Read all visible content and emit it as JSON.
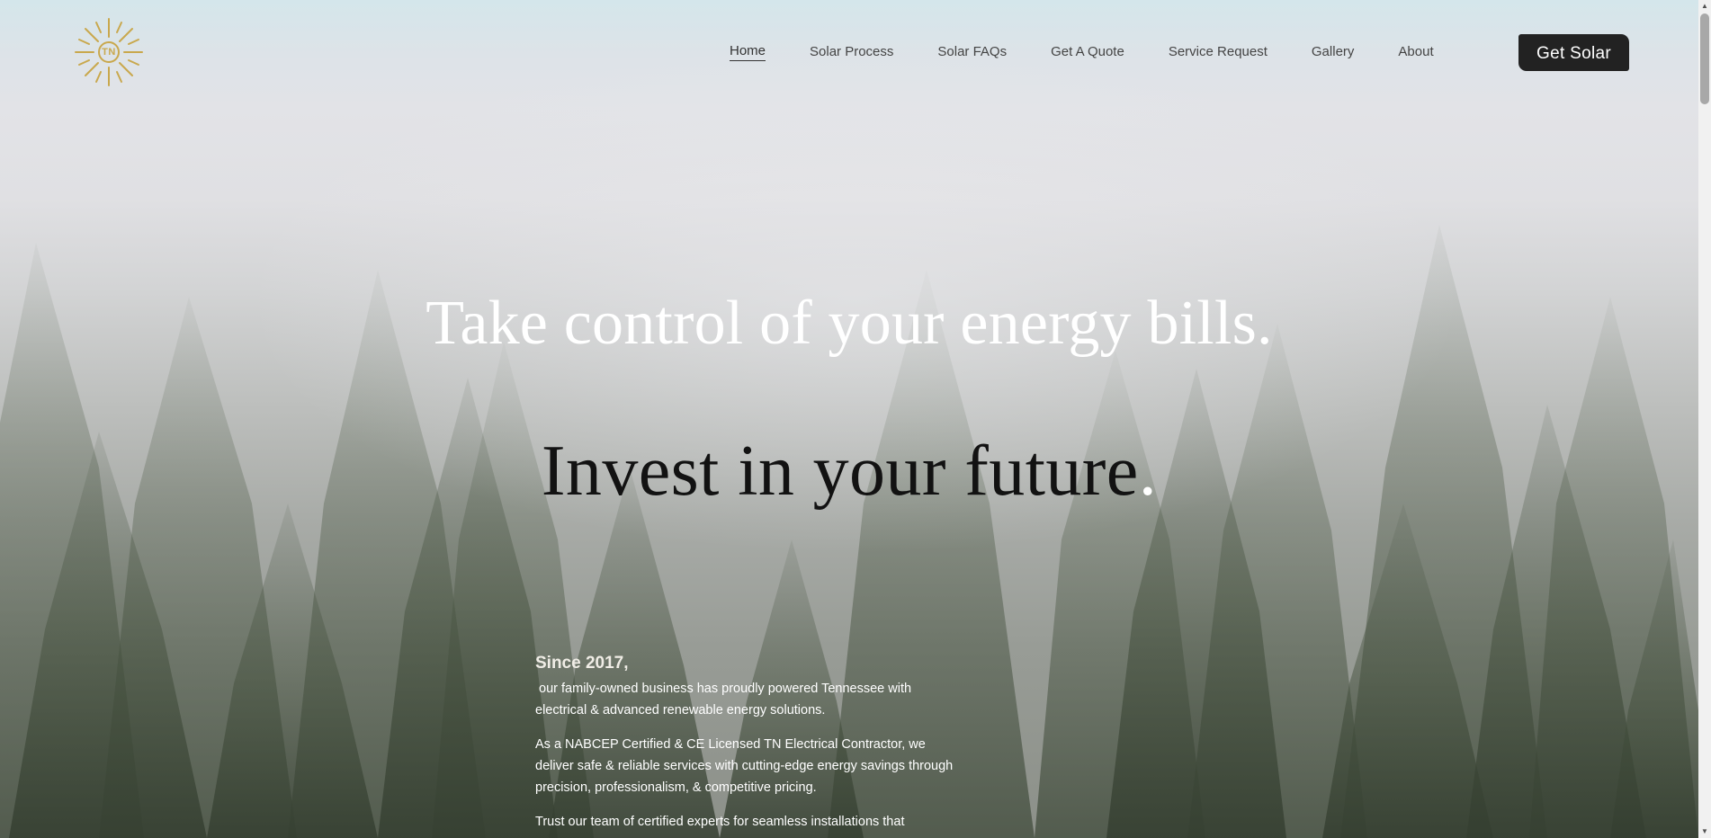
{
  "header": {
    "logo_text": "TN",
    "nav": [
      {
        "label": "Home",
        "active": true
      },
      {
        "label": "Solar Process",
        "active": false
      },
      {
        "label": "Solar FAQs",
        "active": false
      },
      {
        "label": "Get A Quote",
        "active": false
      },
      {
        "label": "Service Request",
        "active": false
      },
      {
        "label": "Gallery",
        "active": false
      },
      {
        "label": "About",
        "active": false
      }
    ],
    "cta_label": "Get Solar"
  },
  "hero": {
    "headline_1": "Take control of your energy bills.",
    "headline_2": "Invest in your future",
    "headline_2_dot": "."
  },
  "intro": {
    "heading": "Since 2017,",
    "paragraphs": [
      " our family-owned business has proudly powered Tennessee with electrical & advanced renewable energy solutions.",
      "As a NABCEP Certified & CE Licensed TN Electrical Contractor, we deliver safe & reliable services with cutting-edge energy savings through precision, professionalism, & competitive pricing.",
      "Trust our team of certified experts for seamless installations that"
    ]
  },
  "colors": {
    "logo_gold": "#c9a84d",
    "cta_background": "#222222",
    "headline_light": "#ffffff",
    "headline_dark": "#121212"
  },
  "icons": {
    "logo": "sun-icon",
    "scroll_up": "triangle-up-icon",
    "scroll_down": "triangle-down-icon"
  }
}
